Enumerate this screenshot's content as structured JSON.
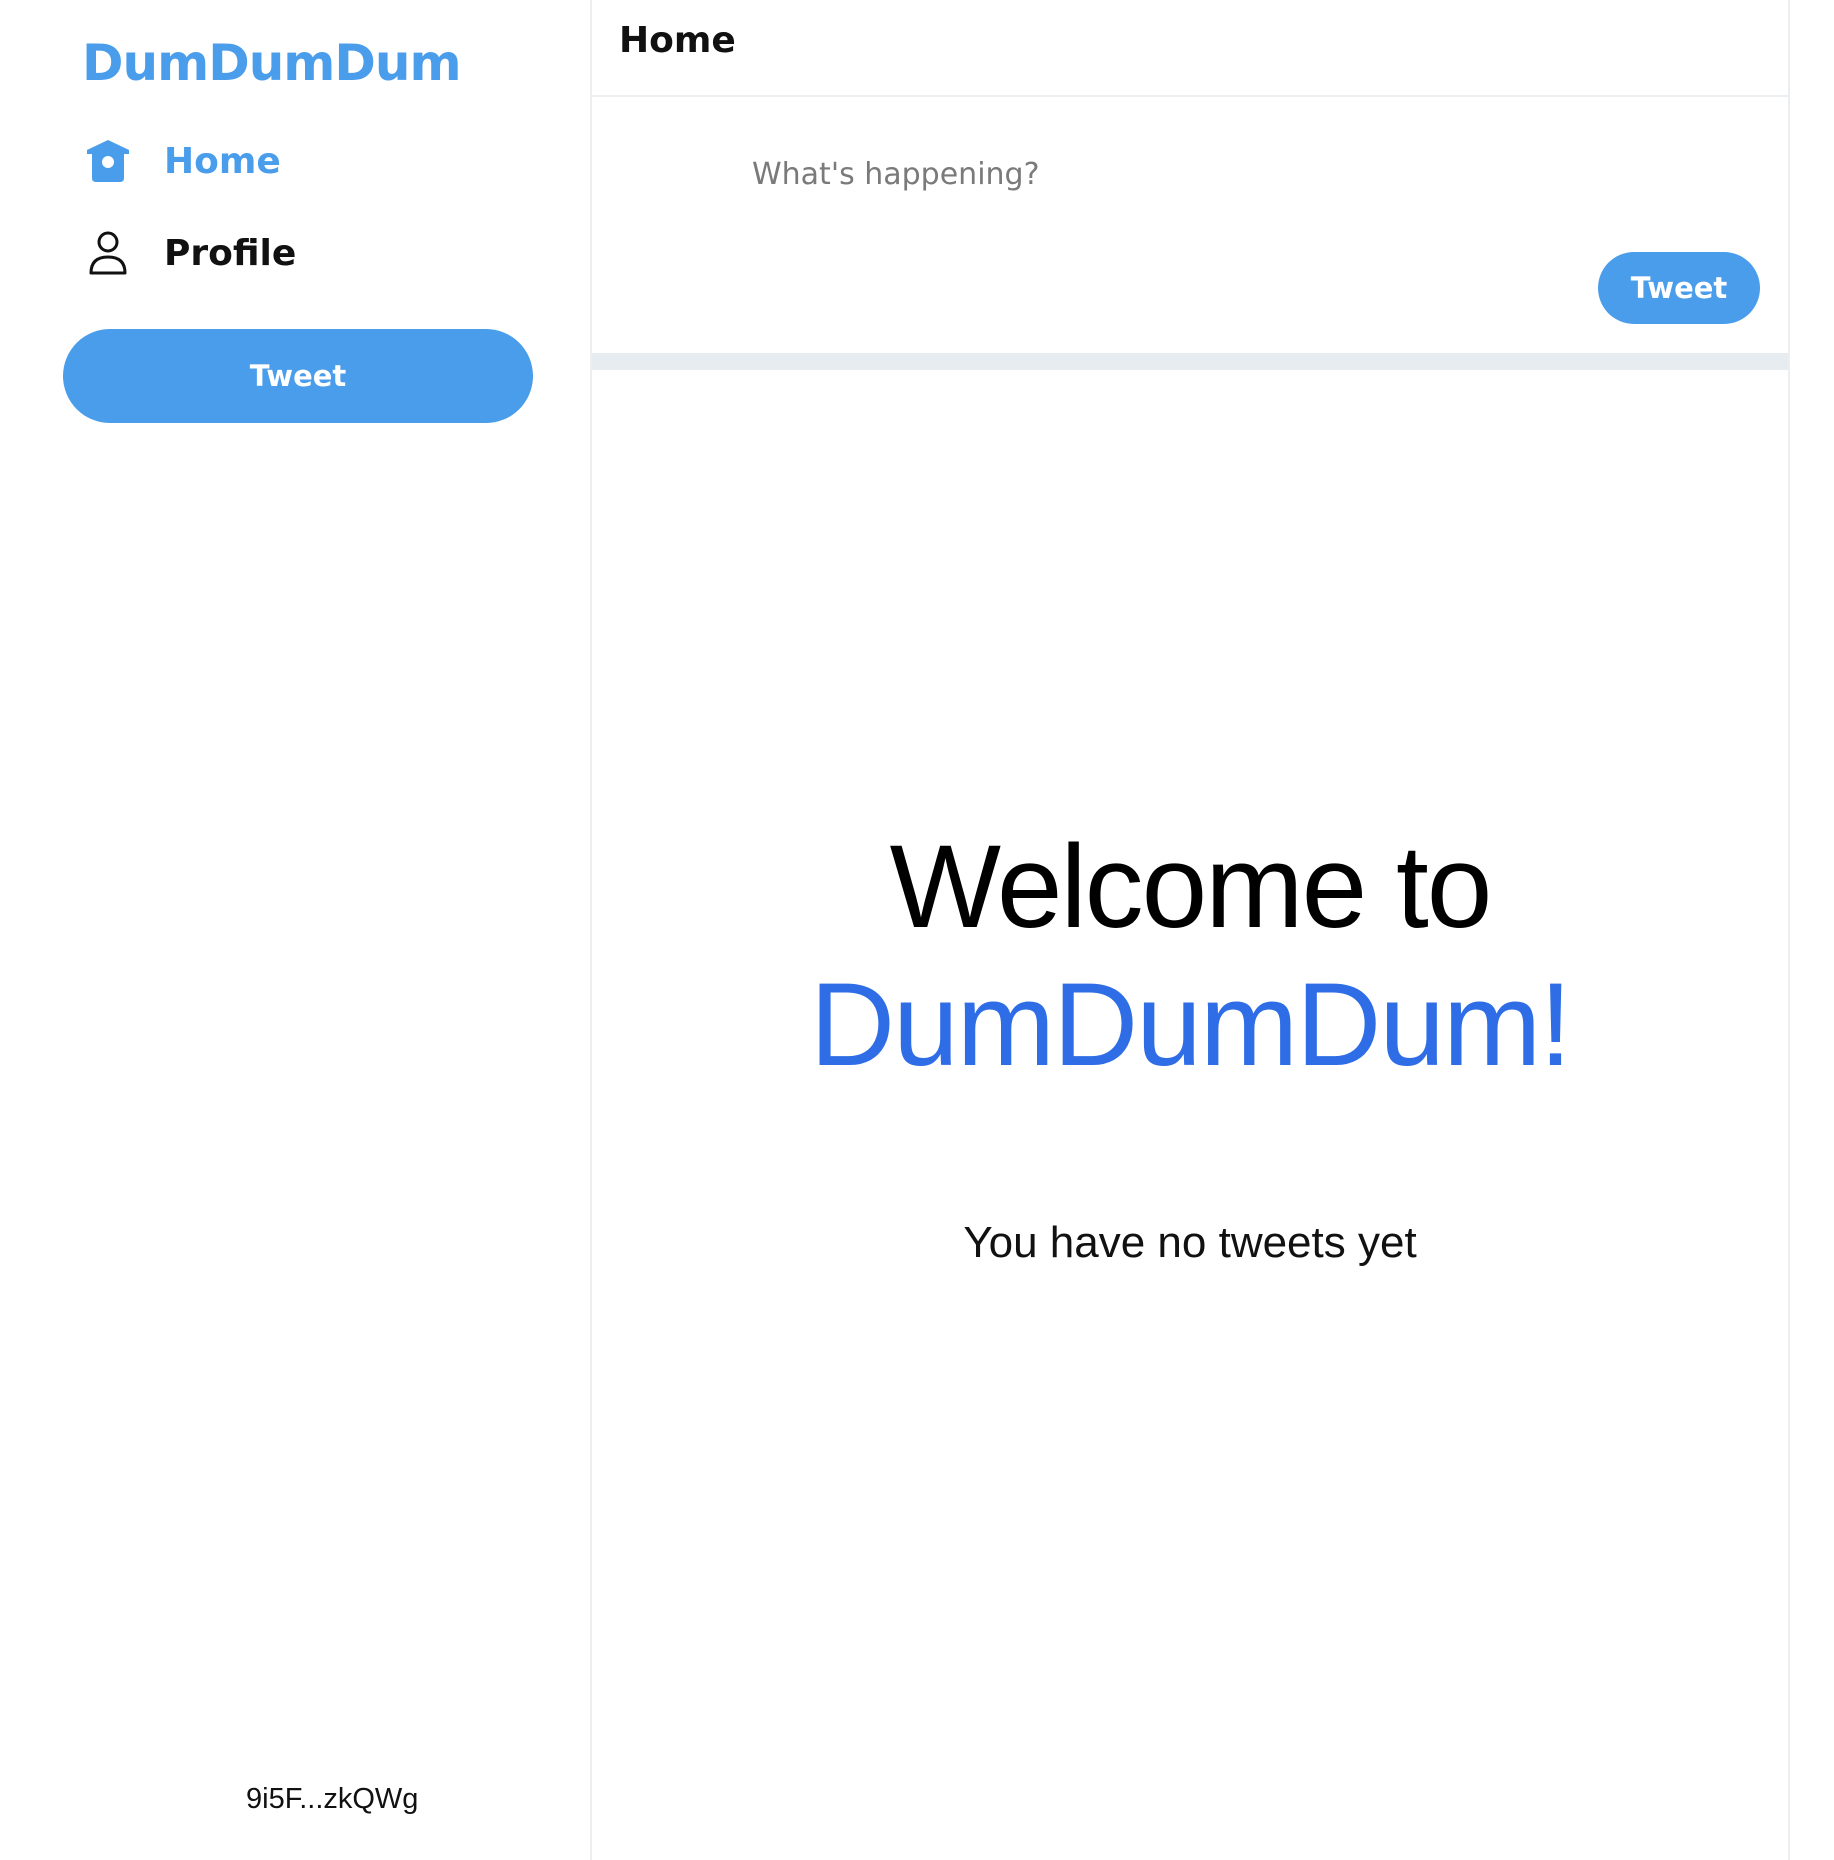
{
  "app": {
    "brand": "DumDumDum"
  },
  "sidebar": {
    "items": [
      {
        "label": "Home",
        "icon": "home-icon",
        "active": true
      },
      {
        "label": "Profile",
        "icon": "user-icon",
        "active": false
      }
    ],
    "tweet_button": "Tweet",
    "account_id": "9i5F...zkQWg"
  },
  "main": {
    "header_title": "Home",
    "composer": {
      "placeholder": "What's happening?",
      "value": "",
      "tweet_button": "Tweet"
    },
    "welcome": {
      "line1": "Welcome to",
      "line2": "DumDumDum!"
    },
    "empty_message": "You have no tweets yet"
  },
  "colors": {
    "accent": "#4a9deb",
    "welcome_accent": "#2f6de6",
    "divider": "#e7ecf0",
    "border": "#eceff2"
  }
}
